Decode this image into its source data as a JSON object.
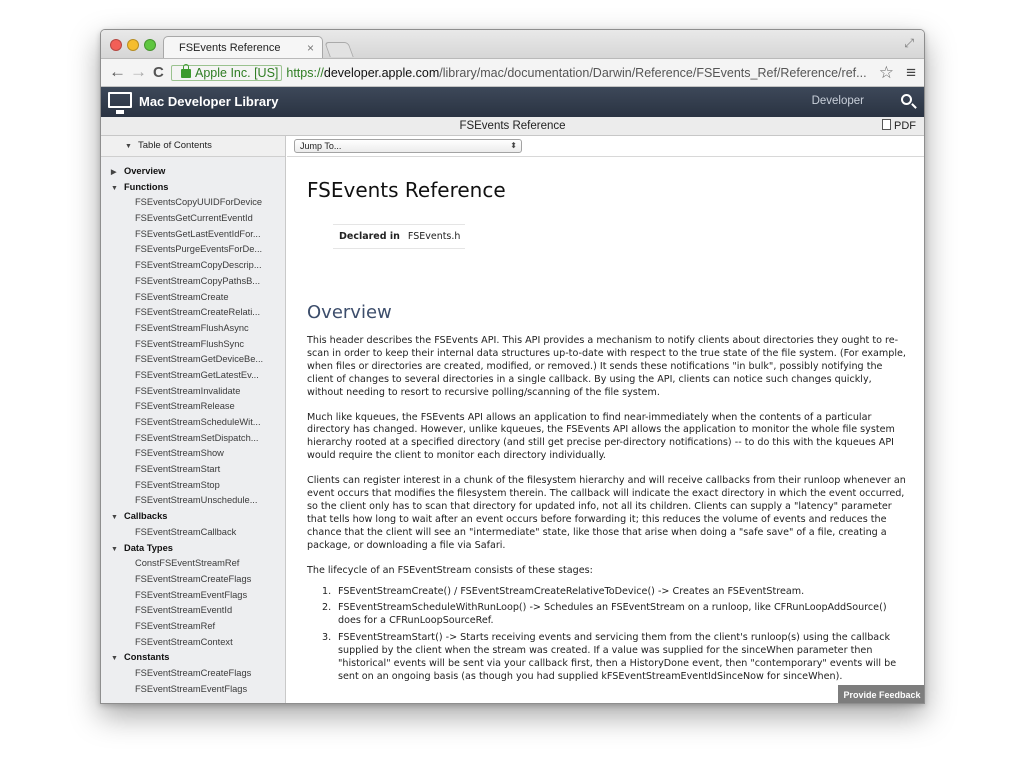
{
  "browser": {
    "tab_title": "FSEvents Reference",
    "tab_close": "×",
    "ev_label": "Apple Inc. [US]",
    "url_scheme": "https://",
    "url_host": "developer.apple.com",
    "url_path": "/library/mac/documentation/Darwin/Reference/FSEvents_Ref/Reference/ref...",
    "back": "←",
    "forward": "→",
    "reload": "C",
    "star": "☆",
    "menu": "≡",
    "fullscreen": "⤢",
    "lights": [
      "#f25f57",
      "#f5bd2d",
      "#5fc640"
    ]
  },
  "header": {
    "library_title": "Mac Developer Library",
    "developer_link": "Developer",
    "apple_glyph": ""
  },
  "doc_bar": {
    "title": "FSEvents Reference",
    "pdf_label": "PDF"
  },
  "sidebar": {
    "toc_label": "Table of Contents",
    "items": [
      {
        "label": "Overview",
        "level": 1,
        "arrow": "▶"
      },
      {
        "label": "Functions",
        "level": 1,
        "arrow": "▼"
      },
      {
        "label": "FSEventsCopyUUIDForDevice",
        "level": 2
      },
      {
        "label": "FSEventsGetCurrentEventId",
        "level": 2
      },
      {
        "label": "FSEventsGetLastEventIdFor...",
        "level": 2
      },
      {
        "label": "FSEventsPurgeEventsForDe...",
        "level": 2
      },
      {
        "label": "FSEventStreamCopyDescrip...",
        "level": 2
      },
      {
        "label": "FSEventStreamCopyPathsB...",
        "level": 2
      },
      {
        "label": "FSEventStreamCreate",
        "level": 2
      },
      {
        "label": "FSEventStreamCreateRelati...",
        "level": 2
      },
      {
        "label": "FSEventStreamFlushAsync",
        "level": 2
      },
      {
        "label": "FSEventStreamFlushSync",
        "level": 2
      },
      {
        "label": "FSEventStreamGetDeviceBe...",
        "level": 2
      },
      {
        "label": "FSEventStreamGetLatestEv...",
        "level": 2
      },
      {
        "label": "FSEventStreamInvalidate",
        "level": 2
      },
      {
        "label": "FSEventStreamRelease",
        "level": 2
      },
      {
        "label": "FSEventStreamScheduleWit...",
        "level": 2
      },
      {
        "label": "FSEventStreamSetDispatch...",
        "level": 2
      },
      {
        "label": "FSEventStreamShow",
        "level": 2
      },
      {
        "label": "FSEventStreamStart",
        "level": 2
      },
      {
        "label": "FSEventStreamStop",
        "level": 2
      },
      {
        "label": "FSEventStreamUnschedule...",
        "level": 2
      },
      {
        "label": "Callbacks",
        "level": 1,
        "arrow": "▼"
      },
      {
        "label": "FSEventStreamCallback",
        "level": 2
      },
      {
        "label": "Data Types",
        "level": 1,
        "arrow": "▼"
      },
      {
        "label": "ConstFSEventStreamRef",
        "level": 2
      },
      {
        "label": "FSEventStreamCreateFlags",
        "level": 2
      },
      {
        "label": "FSEventStreamEventFlags",
        "level": 2
      },
      {
        "label": "FSEventStreamEventId",
        "level": 2
      },
      {
        "label": "FSEventStreamRef",
        "level": 2
      },
      {
        "label": "FSEventStreamContext",
        "level": 2
      },
      {
        "label": "Constants",
        "level": 1,
        "arrow": "▼"
      },
      {
        "label": "FSEventStreamCreateFlags",
        "level": 2
      },
      {
        "label": "FSEventStreamEventFlags",
        "level": 2
      }
    ]
  },
  "content": {
    "jump_to": "Jump To...",
    "title": "FSEvents Reference",
    "declared_in_label": "Declared in",
    "declared_in_value": "FSEvents.h",
    "overview_heading": "Overview",
    "paragraphs": [
      "This header describes the FSEvents API. This API provides a mechanism to notify clients about directories they ought to re-scan in order to keep their internal data structures up-to-date with respect to the true state of the file system. (For example, when files or directories are created, modified, or removed.) It sends these notifications \"in bulk\", possibly notifying the client of changes to several directories in a single callback. By using the API, clients can notice such changes quickly, without needing to resort to recursive polling/scanning of the file system.",
      "Much like kqueues, the FSEvents API allows an application to find near-immediately when the contents of a particular directory has changed. However, unlike kqueues, the FSEvents API allows the application to monitor the whole file system hierarchy rooted at a specified directory (and still get precise per-directory notifications) -- to do this with the kqueues API would require the client to monitor each directory individually.",
      "Clients can register interest in a chunk of the filesystem hierarchy and will receive callbacks from their runloop whenever an event occurs that modifies the filesystem therein. The callback will indicate the exact directory in which the event occurred, so the client only has to scan that directory for updated info, not all its children. Clients can supply a \"latency\" parameter that tells how long to wait after an event occurs before forwarding it; this reduces the volume of events and reduces the chance that the client will see an \"intermediate\" state, like those that arise when doing a \"safe save\" of a file, creating a package, or downloading a file via Safari.",
      "The lifecycle of an FSEventStream consists of these stages:"
    ],
    "steps": [
      {
        "num": "1.",
        "text": "FSEventStreamCreate() / FSEventStreamCreateRelativeToDevice() -> Creates an FSEventStream."
      },
      {
        "num": "2.",
        "text": "FSEventStreamScheduleWithRunLoop() -> Schedules an FSEventStream on a runloop, like CFRunLoopAddSource() does for a CFRunLoopSourceRef."
      },
      {
        "num": "3.",
        "text": "FSEventStreamStart() -> Starts receiving events and servicing them from the client's runloop(s) using the callback supplied by the client when the stream was created. If a value was supplied for the sinceWhen parameter then \"historical\" events will be sent via your callback first, then a HistoryDone event, then \"contemporary\" events will be sent on an ongoing basis (as though you had supplied kFSEventStreamEventIdSinceNow for sinceWhen)."
      }
    ],
    "feedback_button": "Provide Feedback"
  }
}
